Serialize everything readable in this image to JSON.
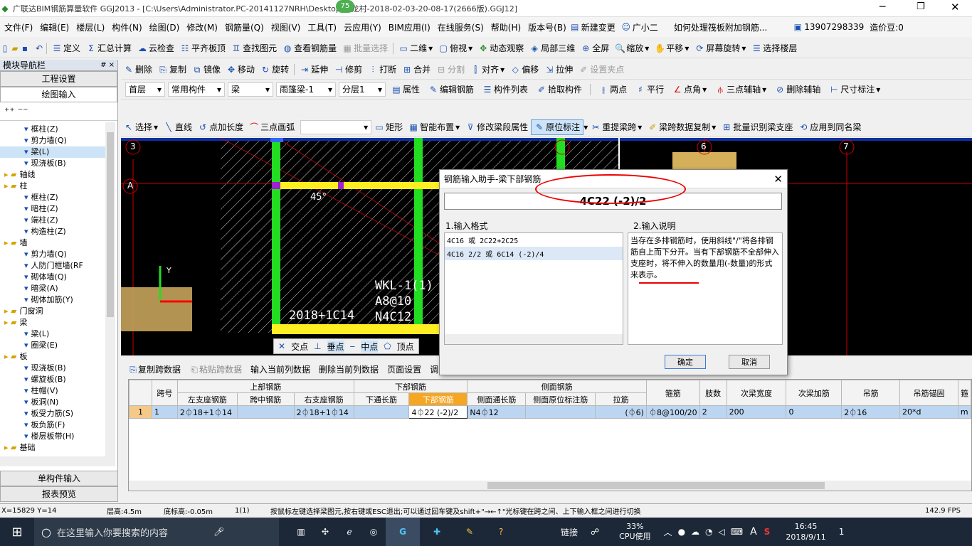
{
  "title": {
    "text": "广联达BIM钢筋算量软件 GGJ2013 - [C:\\Users\\Administrator.PC-20141127NRH\\Desktop\\白龙村-2018-02-03-20-08-17(2666版).GGJ12]",
    "badge": "75"
  },
  "menu": [
    "文件(F)",
    "编辑(E)",
    "楼层(L)",
    "构件(N)",
    "绘图(D)",
    "修改(M)",
    "钢筋量(Q)",
    "视图(V)",
    "工具(T)",
    "云应用(Y)",
    "BIM应用(I)",
    "在线服务(S)",
    "帮助(H)",
    "版本号(B)",
    "新建变更",
    "广小二",
    "如何处理筏板附加钢筋...",
    "13907298339",
    "造价豆:0"
  ],
  "tb1": [
    "定义",
    "汇总计算",
    "云检查",
    "平齐板顶",
    "查找图元",
    "查看钢筋量",
    "批量选择",
    "二维",
    "俯视",
    "动态观察",
    "局部三维",
    "全屏",
    "缩放",
    "平移",
    "屏幕旋转",
    "选择楼层"
  ],
  "tb2": [
    "删除",
    "复制",
    "镜像",
    "移动",
    "旋转",
    "延伸",
    "修剪",
    "打断",
    "合并",
    "分割",
    "对齐",
    "偏移",
    "拉伸",
    "设置夹点"
  ],
  "tb3": {
    "floor": "首层",
    "cat": "常用构件",
    "type": "梁",
    "sub": "雨篷梁-1",
    "layer": "分层1",
    "items": [
      "属性",
      "编辑钢筋",
      "构件列表",
      "拾取构件",
      "两点",
      "平行",
      "点角",
      "三点辅轴",
      "删除辅轴",
      "尺寸标注"
    ]
  },
  "tb4": [
    "选择",
    "直线",
    "点加长度",
    "三点画弧",
    "矩形",
    "智能布置",
    "修改梁段属性",
    "原位标注",
    "重提梁跨",
    "梁跨数据复制",
    "批量识别梁支座",
    "应用到同名梁"
  ],
  "nav": {
    "title": "模块导航栏",
    "pin": "# ×",
    "btn1": "工程设置",
    "btn2": "绘图输入",
    "tree": [
      {
        "t": "框柱(Z)",
        "l": 3
      },
      {
        "t": "剪力墙(Q)",
        "l": 3
      },
      {
        "t": "梁(L)",
        "l": 3
      },
      {
        "t": "现浇板(B)",
        "l": 3
      },
      {
        "t": "轴线",
        "l": 1
      },
      {
        "t": "柱",
        "l": 1
      },
      {
        "t": "框柱(Z)",
        "l": 3
      },
      {
        "t": "暗柱(Z)",
        "l": 3
      },
      {
        "t": "端柱(Z)",
        "l": 3
      },
      {
        "t": "构造柱(Z)",
        "l": 3
      },
      {
        "t": "墙",
        "l": 1
      },
      {
        "t": "剪力墙(Q)",
        "l": 3
      },
      {
        "t": "人防门框墙(RF",
        "l": 3
      },
      {
        "t": "砌体墙(Q)",
        "l": 3
      },
      {
        "t": "暗梁(A)",
        "l": 3
      },
      {
        "t": "砌体加筋(Y)",
        "l": 3
      },
      {
        "t": "门窗洞",
        "l": 1
      },
      {
        "t": "梁",
        "l": 1
      },
      {
        "t": "梁(L)",
        "l": 3
      },
      {
        "t": "圈梁(E)",
        "l": 3
      },
      {
        "t": "板",
        "l": 1
      },
      {
        "t": "现浇板(B)",
        "l": 3
      },
      {
        "t": "螺旋板(B)",
        "l": 3
      },
      {
        "t": "柱帽(V)",
        "l": 3
      },
      {
        "t": "板洞(N)",
        "l": 3
      },
      {
        "t": "板受力筋(S)",
        "l": 3
      },
      {
        "t": "板负筋(F)",
        "l": 3
      },
      {
        "t": "楼层板带(H)",
        "l": 3
      },
      {
        "t": "基础",
        "l": 1
      }
    ],
    "btn3": "单构件输入",
    "btn4": "报表预览"
  },
  "canvas": {
    "axes": [
      "3",
      "A",
      "6",
      "7"
    ],
    "angle": "45°",
    "texts": [
      "WKL-1(1)",
      "A8@10",
      "N4C12",
      "2018+1C14"
    ],
    "snap": [
      "交点",
      "垂点",
      "中点",
      "顶点"
    ],
    "coord": "Y"
  },
  "gridtb": [
    "复制跨数据",
    "粘贴跨数据",
    "输入当前列数据",
    "删除当前列数据",
    "页面设置",
    "调"
  ],
  "table": {
    "h1": [
      "跨号",
      "上部钢筋",
      "下部钢筋",
      "侧面钢筋",
      "箍筋",
      "肢数",
      "次梁宽度",
      "次梁加筋",
      "吊筋",
      "吊筋锚固",
      "箍"
    ],
    "h2": [
      "左支座钢筋",
      "跨中钢筋",
      "右支座钢筋",
      "下通长筋",
      "下部钢筋",
      "侧面通长筋",
      "侧面原位标注筋",
      "拉筋"
    ],
    "row": [
      "1",
      "1",
      "2⏀18+1⏀14",
      "",
      "2⏀18+1⏀14",
      "",
      "4⏀22 (-2)/2",
      "N4⏀12",
      "",
      "(⏀6)",
      "⏀8@100/20",
      "2",
      "200",
      "0",
      "2⏀16",
      "20*d",
      "m"
    ]
  },
  "dialog": {
    "title": "钢筋输入助手-梁下部钢筋",
    "value": "4C22 (-2)/2",
    "l1": "1.输入格式",
    "l2": "2.输入说明",
    "formats": [
      "4C16 或 2C22+2C25",
      "4C16 2/2 或 6C14 (-2)/4"
    ],
    "desc": "当存在多排钢筋时，使用斜线\"/\"将各排钢筋自上而下分开。当有下部钢筋不全部伸入支座时，将不伸入的数量用(-数量)的形式来表示。",
    "ok": "确定",
    "cancel": "取消"
  },
  "status": [
    "X=15829 Y=14",
    "层高:4.5m",
    "底标高:-0.05m",
    "1(1)",
    "按鼠标左键选择梁图元,按右键或ESC退出;可以通过回车键及shift+\"→←↑\"光标键在跨之间、上下输入框之间进行切换",
    "142.9 FPS"
  ],
  "taskbar": {
    "search": "在这里输入你要搜索的内容",
    "link": "链接",
    "cpu": "33%",
    "cpulabel": "CPU使用",
    "lang": "A",
    "time": "16:45",
    "date": "2018/9/11",
    "notif": "1"
  }
}
